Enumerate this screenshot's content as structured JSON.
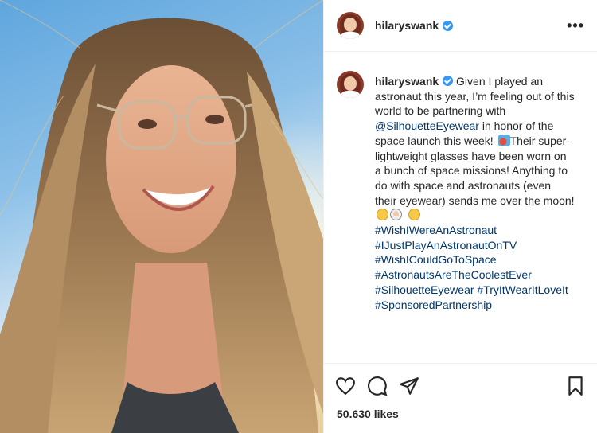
{
  "post": {
    "username": "hilaryswank",
    "more_label": "•••"
  },
  "caption": {
    "username": "hilaryswank",
    "body_1": " Given I played an astronaut this year, I’m feeling out of this world to be partnering with ",
    "mention": "@SilhouetteEyewear",
    "body_2": " in honor of the space launch this week! ",
    "body_3": "Their super-lightweight glasses have been worn on a bunch of space missions! Anything to do with space and astronauts (even their eyewear) sends me over the moon! ",
    "hashtags": [
      "#WishIWereAnAstronaut",
      "#IJustPlayAnAstronautOnTV",
      "#WishICouldGoToSpace",
      "#AstronautsAreTheCoolestEver",
      "#SilhouetteEyewear #TryItWearItLoveIt",
      "#SponsoredPartnership"
    ],
    "emoji": [
      "rocket-emoji",
      "laughing-emoji",
      "astronaut-emoji",
      "smile-emoji"
    ]
  },
  "stats": {
    "likes": "50.630 likes"
  },
  "icons": [
    "heart-icon",
    "comment-icon",
    "share-icon",
    "bookmark-icon",
    "verified-badge-icon",
    "more-options-icon"
  ],
  "colors": {
    "link": "#00376b",
    "verified": "#3897f0",
    "text": "#262626",
    "border": "#efefef"
  }
}
